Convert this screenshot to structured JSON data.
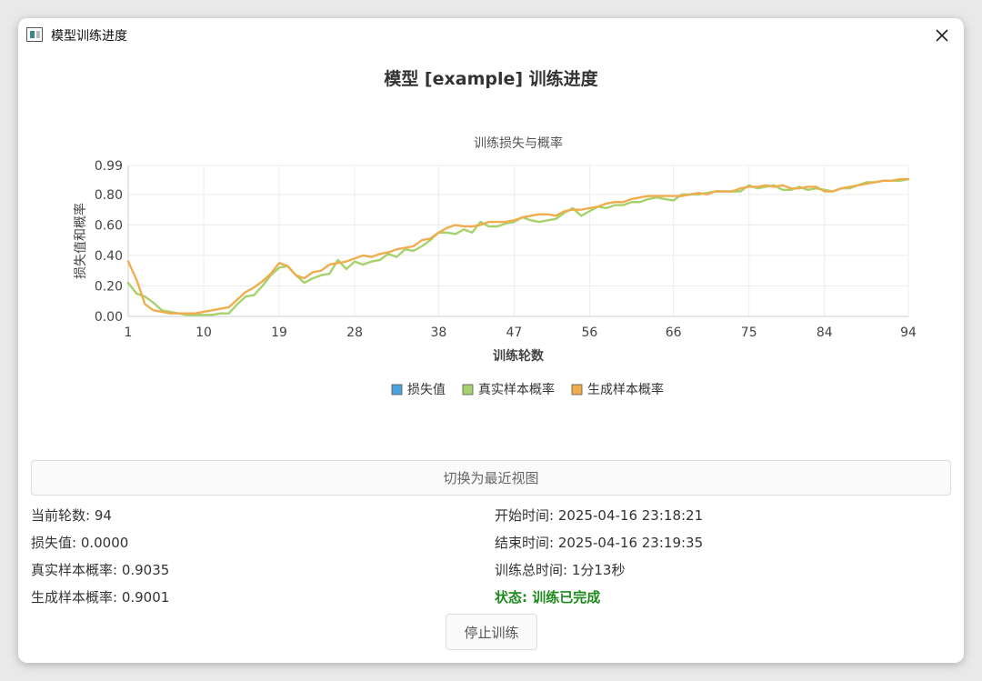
{
  "window": {
    "title": "模型训练进度",
    "close_icon": "close-icon"
  },
  "page_title": "模型 [example] 训练进度",
  "chart_data": {
    "type": "line",
    "title": "训练损失与概率",
    "xlabel": "训练轮数",
    "ylabel": "损失值和概率",
    "xlim": [
      1,
      94
    ],
    "ylim": [
      0,
      0.99
    ],
    "x_ticks": [
      1,
      10,
      19,
      28,
      38,
      47,
      56,
      66,
      75,
      84,
      94
    ],
    "y_ticks": [
      "0.00",
      "0.20",
      "0.40",
      "0.60",
      "0.80",
      "0.99"
    ],
    "legend_position": "bottom",
    "grid": true,
    "series": [
      {
        "name": "损失值",
        "color": "#4aa3df",
        "values": []
      },
      {
        "name": "真实样本概率",
        "color": "#a6d26b",
        "values": [
          0.22,
          0.15,
          0.13,
          0.09,
          0.04,
          0.03,
          0.02,
          0.01,
          0.01,
          0.01,
          0.01,
          0.02,
          0.02,
          0.08,
          0.13,
          0.14,
          0.2,
          0.27,
          0.32,
          0.33,
          0.27,
          0.22,
          0.25,
          0.27,
          0.28,
          0.37,
          0.31,
          0.36,
          0.34,
          0.36,
          0.37,
          0.41,
          0.39,
          0.44,
          0.43,
          0.46,
          0.5,
          0.55,
          0.55,
          0.54,
          0.57,
          0.55,
          0.62,
          0.59,
          0.59,
          0.61,
          0.62,
          0.65,
          0.63,
          0.62,
          0.63,
          0.64,
          0.68,
          0.71,
          0.66,
          0.69,
          0.72,
          0.71,
          0.73,
          0.73,
          0.75,
          0.75,
          0.77,
          0.78,
          0.77,
          0.76,
          0.8,
          0.8,
          0.8,
          0.81,
          0.82,
          0.82,
          0.82,
          0.82,
          0.86,
          0.84,
          0.85,
          0.86,
          0.83,
          0.83,
          0.85,
          0.83,
          0.84,
          0.83,
          0.82,
          0.84,
          0.84,
          0.86,
          0.88,
          0.88,
          0.89,
          0.89,
          0.89,
          0.9
        ]
      },
      {
        "name": "生成样本概率",
        "color": "#f0ad4e",
        "values": [
          0.36,
          0.24,
          0.08,
          0.04,
          0.03,
          0.02,
          0.02,
          0.02,
          0.02,
          0.03,
          0.04,
          0.05,
          0.06,
          0.11,
          0.16,
          0.19,
          0.23,
          0.28,
          0.35,
          0.33,
          0.27,
          0.25,
          0.29,
          0.3,
          0.34,
          0.35,
          0.36,
          0.38,
          0.4,
          0.39,
          0.41,
          0.42,
          0.44,
          0.45,
          0.46,
          0.5,
          0.51,
          0.55,
          0.58,
          0.6,
          0.59,
          0.59,
          0.6,
          0.62,
          0.62,
          0.62,
          0.63,
          0.65,
          0.66,
          0.67,
          0.67,
          0.66,
          0.69,
          0.7,
          0.7,
          0.71,
          0.72,
          0.74,
          0.75,
          0.75,
          0.77,
          0.78,
          0.79,
          0.79,
          0.79,
          0.79,
          0.79,
          0.8,
          0.81,
          0.8,
          0.82,
          0.82,
          0.82,
          0.84,
          0.85,
          0.85,
          0.86,
          0.85,
          0.86,
          0.84,
          0.84,
          0.85,
          0.85,
          0.82,
          0.82,
          0.84,
          0.85,
          0.86,
          0.87,
          0.88,
          0.89,
          0.89,
          0.9,
          0.9
        ]
      }
    ]
  },
  "toggle_button": "切换为最近视图",
  "stats": {
    "epoch": "当前轮数: 94",
    "loss": "损失值: 0.0000",
    "real_prob": "真实样本概率: 0.9035",
    "fake_prob": "生成样本概率: 0.9001",
    "start_time": "开始时间: 2025-04-16 23:18:21",
    "end_time": "结束时间: 2025-04-16 23:19:35",
    "total_time": "训练总时间: 1分13秒",
    "status": "状态: 训练已完成"
  },
  "stop_button": "停止训练"
}
